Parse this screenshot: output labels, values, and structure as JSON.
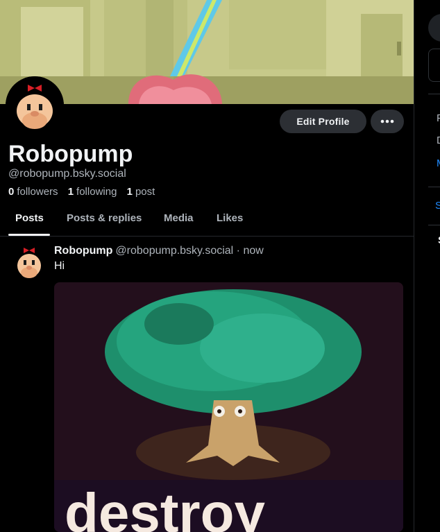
{
  "profile": {
    "display_name": "Robopump",
    "handle": "@robopump.bsky.social",
    "followers_count": "0",
    "followers_label": "followers",
    "following_count": "1",
    "following_label": "following",
    "posts_count": "1",
    "posts_label": "post"
  },
  "actions": {
    "edit_profile": "Edit Profile",
    "more": "•••"
  },
  "tabs": [
    {
      "label": "Posts",
      "active": true
    },
    {
      "label": "Posts & replies",
      "active": false
    },
    {
      "label": "Media",
      "active": false
    },
    {
      "label": "Likes",
      "active": false
    }
  ],
  "post": {
    "author": "Robopump",
    "handle": "@robopump.bsky.social",
    "separator": "·",
    "time": "now",
    "text": "Hi",
    "image_caption": "destroy"
  },
  "sidebar": {
    "line1": "F",
    "line2": "D",
    "link1": "M",
    "link2": "S",
    "line3": "S"
  },
  "colors": {
    "background": "#000000",
    "accent": "#208bfe",
    "button_bg": "#2c2f34",
    "muted_text": "#aeb4bb"
  }
}
